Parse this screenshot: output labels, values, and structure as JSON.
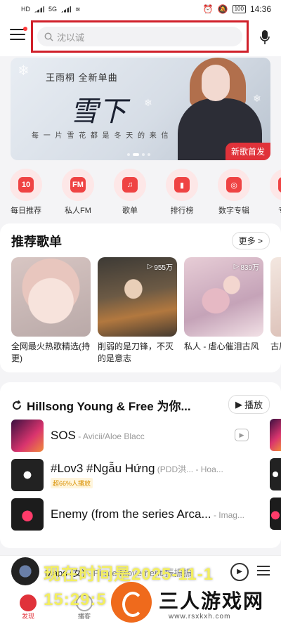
{
  "status_bar": {
    "left_badges": [
      "HD",
      "HD"
    ],
    "network": "5G",
    "battery": "100",
    "time": "14:36"
  },
  "search": {
    "placeholder": "沈以诚"
  },
  "banner": {
    "title": "王雨桐  全新单曲",
    "calligraphy": "雪下",
    "subtitle": "每 一 片 雪 花   都 是 冬 天 的 来 信",
    "tag": "新歌首发"
  },
  "shortcuts": [
    {
      "label": "每日推荐",
      "glyph": "10"
    },
    {
      "label": "私人FM",
      "glyph": "FM"
    },
    {
      "label": "歌单",
      "glyph": "♫"
    },
    {
      "label": "排行榜",
      "glyph": "▮"
    },
    {
      "label": "数字专辑",
      "glyph": "◎"
    },
    {
      "label": "专访",
      "glyph": "✦"
    }
  ],
  "recommended": {
    "title": "推荐歌单",
    "more": "更多 >",
    "playlists": [
      {
        "title": "全网最火热歌精选(持更)",
        "count": ""
      },
      {
        "title": "削弱的是刀锋，不灭的是意志",
        "count": "955万"
      },
      {
        "title": "私人 - 虐心催泪古风",
        "count": "839万"
      },
      {
        "title": "古风的",
        "count": ""
      }
    ]
  },
  "hillsong": {
    "title": "Hillsong Young & Free 为你...",
    "play_label": "播放",
    "songs": [
      {
        "name": "SOS",
        "artist": " - Avicii/Aloe Blacc",
        "badge": ""
      },
      {
        "name": "#Lov3 #Ngẫu Hứng",
        "artist": " (PDD洪... - Hoa...",
        "badge": "超66%人播放"
      },
      {
        "name": "Enemy (from the series Arca...",
        "artist": " - Imag...",
        "badge": ""
      }
    ]
  },
  "player": {
    "title": "Maps (女)",
    "subtitle": " - Pirate Movement/振振振",
    "play_glyph": "▶"
  },
  "tabs": [
    {
      "label": "发现",
      "active": true
    },
    {
      "label": "播客",
      "active": false
    },
    {
      "label": "",
      "active": false
    },
    {
      "label": "",
      "active": false
    },
    {
      "label": "",
      "active": false
    }
  ],
  "watermark": {
    "timestamp": "现在时间是2025-11-1 15:29:5",
    "site_name": "三人游戏网",
    "site_url": "www.rsxkxh.com"
  }
}
